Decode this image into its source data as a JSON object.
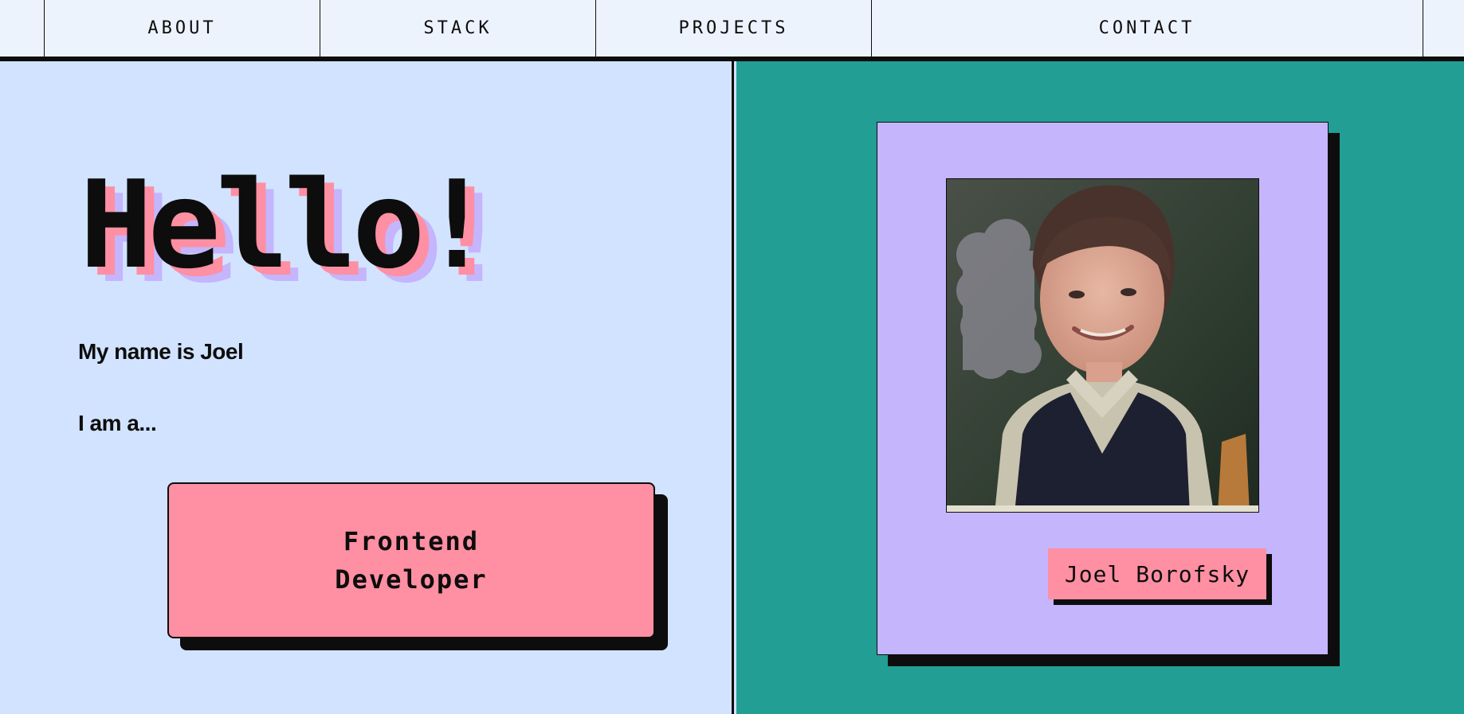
{
  "nav": {
    "items": [
      {
        "label": "ABOUT"
      },
      {
        "label": "STACK"
      },
      {
        "label": "PROJECTS"
      },
      {
        "label": "CONTACT"
      }
    ]
  },
  "hero": {
    "greeting": "Hello!",
    "name_line": "My name is Joel",
    "role_intro": "I am a...",
    "role": "Frontend\nDeveloper"
  },
  "profile": {
    "photo_alt": "Joel Borofsky",
    "name_tag": "Joel Borofsky"
  },
  "colors": {
    "nav_bg": "#edf3fd",
    "left_bg": "#d2e3ff",
    "right_bg": "#229e94",
    "pink": "#ff8fa3",
    "lavender": "#c4b5fd",
    "ink": "#0d0d0d"
  }
}
